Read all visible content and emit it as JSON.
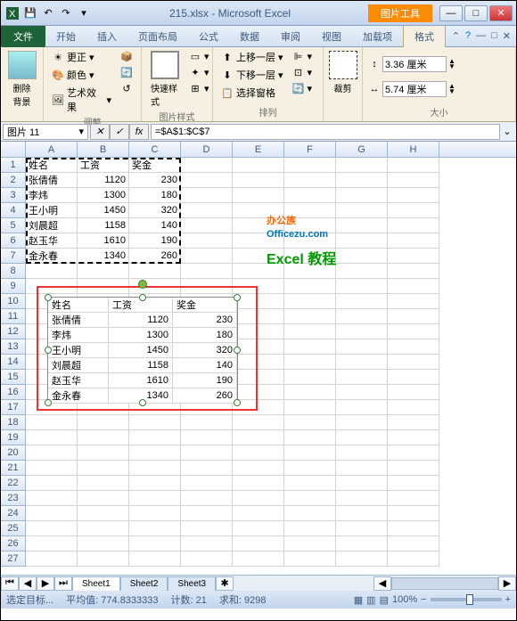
{
  "title": "215.xlsx - Microsoft Excel",
  "pictools": "图片工具",
  "tabs": {
    "file": "文件",
    "home": "开始",
    "insert": "插入",
    "layout": "页面布局",
    "formula": "公式",
    "data": "数据",
    "review": "审阅",
    "view": "视图",
    "addins": "加载项",
    "format": "格式"
  },
  "ribbon": {
    "removebg": "删除背景",
    "adjust": {
      "correct": "更正",
      "color": "颜色",
      "effect": "艺术效果",
      "label": "调整"
    },
    "styles": {
      "quick": "快速样式",
      "label": "图片样式"
    },
    "arrange": {
      "forward": "上移一层",
      "backward": "下移一层",
      "selection": "选择窗格",
      "label": "排列"
    },
    "crop": "裁剪",
    "size": {
      "h": "3.36 厘米",
      "w": "5.74 厘米",
      "label": "大小"
    }
  },
  "namebox": "图片 11",
  "formula": "=$A$1:$C$7",
  "cols": [
    "A",
    "B",
    "C",
    "D",
    "E",
    "F",
    "G",
    "H"
  ],
  "rowcount": 27,
  "chart_data": {
    "type": "table",
    "headers": [
      "姓名",
      "工资",
      "奖金"
    ],
    "rows": [
      [
        "张倩倩",
        1120,
        230
      ],
      [
        "李炜",
        1300,
        180
      ],
      [
        "王小明",
        1450,
        320
      ],
      [
        "刘晨超",
        1158,
        140
      ],
      [
        "赵玉华",
        1610,
        190
      ],
      [
        "金永春",
        1340,
        260
      ]
    ]
  },
  "watermark": {
    "l1": "办公族",
    "l2": "Officezu.com",
    "l3": "Excel 教程"
  },
  "sheets": [
    "Sheet1",
    "Sheet2",
    "Sheet3"
  ],
  "status": {
    "mode": "选定目标...",
    "avg": "平均值: 774.8333333",
    "count": "计数: 21",
    "sum": "求和: 9298",
    "zoom": "100%"
  }
}
